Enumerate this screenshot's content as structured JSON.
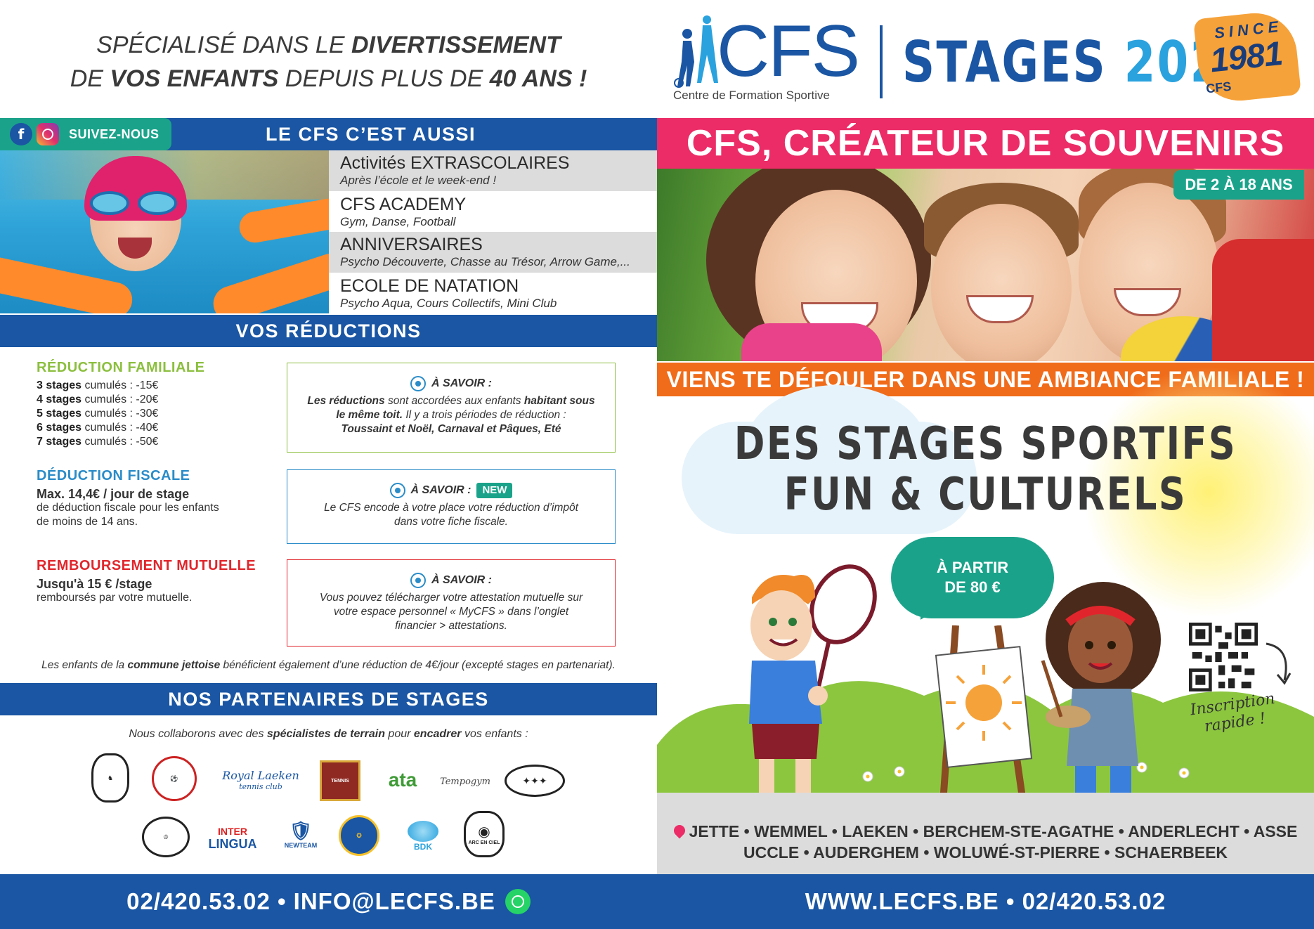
{
  "left": {
    "tagline": {
      "l1a": "SPÉCIALISÉ DANS LE ",
      "l1b": "DIVERTISSEMENT",
      "l2a": "DE ",
      "l2b": "VOS ENFANTS",
      "l2c": " DEPUIS PLUS DE ",
      "l2d": "40 ANS !"
    },
    "social_label": "SUIVEZ-NOUS",
    "aussi_title": "LE CFS C’EST AUSSI",
    "activities": [
      {
        "title": "Activités EXTRASCOLAIRES",
        "sub": "Après l’école et le week-end !"
      },
      {
        "title": "CFS ACADEMY",
        "sub": "Gym, Danse, Football"
      },
      {
        "title": "ANNIVERSAIRES",
        "sub": "Psycho Découverte, Chasse au Trésor, Arrow Game,..."
      },
      {
        "title": "ECOLE DE NATATION",
        "sub": "Psycho Aqua, Cours Collectifs, Mini Club"
      }
    ],
    "reductions_title": "VOS RÉDUCTIONS",
    "familiale": {
      "title": "RÉDUCTION FAMILIALE",
      "rows": [
        {
          "n": "3 stages",
          "t": " cumulés : -15€"
        },
        {
          "n": "4 stages",
          "t": " cumulés : -20€"
        },
        {
          "n": "5 stages",
          "t": " cumulés : -30€"
        },
        {
          "n": "6 stages",
          "t": " cumulés : -40€"
        },
        {
          "n": "7 stages",
          "t": " cumulés : -50€"
        }
      ]
    },
    "fiscale": {
      "title": "DÉDUCTION FISCALE",
      "bold": "Max. 14,4€ / jour de stage",
      "l1": "de déduction fiscale pour les enfants",
      "l2": "de moins de 14 ans."
    },
    "mutuelle": {
      "title": "REMBOURSEMENT MUTUELLE",
      "bold": "Jusqu'à 15 € /stage",
      "l1": "remboursés par votre mutuelle."
    },
    "savoir_label": "À SAVOIR :",
    "new_label": "NEW",
    "box1": {
      "b1": "Les réductions",
      "t1": " sont accordées aux enfants ",
      "b2": "habitant sous",
      "b3": "le même toit.",
      "t2": " Il y a trois périodes de réduction :",
      "b4": "Toussaint et Noël, Carnaval et Pâques, Eté"
    },
    "box2": {
      "l1": "Le CFS encode à votre place votre réduction d’impôt",
      "l2": "dans votre fiche fiscale."
    },
    "box3": {
      "l1": "Vous pouvez télécharger votre attestation mutuelle sur",
      "l2": "votre espace personnel « MyCFS » dans l’onglet",
      "l3": "financier > attestations."
    },
    "jette": {
      "a": "Les enfants de la ",
      "b": "commune jettoise",
      "c": " bénéficient également d’une réduction de 4€/jour (excepté stages en partenariat)."
    },
    "partners_title": "NOS PARTENAIRES DE STAGES",
    "collab": {
      "a": "Nous collaborons avec des ",
      "b": "spécialistes de terrain",
      "c": " pour ",
      "d": "encadrer",
      "e": " vos enfants :"
    },
    "partner_logos": {
      "royal": "Royal Laeken",
      "royal_sub": "tennis club",
      "inter": "INTER",
      "lingua": "LINGUA",
      "newteam": "NEWTEAM",
      "bdk": "BDK",
      "ata": "ata",
      "tempogym": "Tempogym",
      "arc": "ARC EN CIEL"
    },
    "footer": "02/420.53.02 • INFO@LECFS.BE"
  },
  "right": {
    "logo_word": "CFS",
    "logo_sub": "Centre de Formation Sportive",
    "stages_w1": "STAGES",
    "stages_w2": "2024",
    "since": "SINCE",
    "since_year": "1981",
    "since_cfs": "CFS",
    "souvenirs": "CFS, CRÉATEUR DE SOUVENIRS",
    "age_badge": "DE 2 À 18 ANS",
    "ambiance": "VIENS TE DÉFOULER DANS UNE AMBIANCE FAMILIALE !",
    "headline_l1": "DES STAGES SPORTIFS",
    "headline_l2": "FUN & CULTURELS",
    "bubble_l1": "À PARTIR",
    "bubble_l2": "DE 80 €",
    "inscription_l1": "Inscription",
    "inscription_l2": "rapide !",
    "locations_l1": "JETTE • WEMMEL • LAEKEN • BERCHEM-STE-AGATHE • ANDERLECHT • ASSE",
    "locations_l2": "UCCLE • AUDERGHEM • WOLUWÉ-ST-PIERRE • SCHAERBEEK",
    "footer": "WWW.LECFS.BE • 02/420.53.02"
  },
  "colors": {
    "blue": "#1a56a3",
    "light_blue": "#2aa2de",
    "teal": "#1aa38a",
    "pink": "#ec2c67",
    "orange": "#f06c1a",
    "green": "#8cbf3f",
    "fiscal_blue": "#2a8cc8",
    "red": "#e0262c"
  }
}
